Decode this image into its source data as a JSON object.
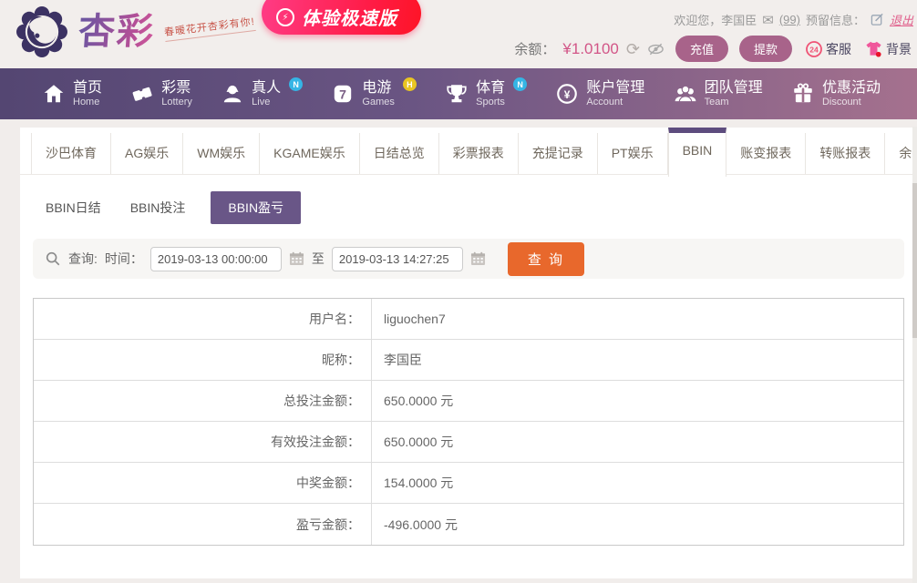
{
  "brand": {
    "name": "杏彩",
    "tagline": "春暖花开杏彩有你!",
    "speed_badge": "体验极速版"
  },
  "topbar": {
    "welcome": "欢迎您，李国臣",
    "mail_count": "(99)",
    "reserved_label": "预留信息：",
    "logout": "退出"
  },
  "balance": {
    "label": "余额：",
    "amount": "¥1.0100",
    "deposit": "充值",
    "withdraw": "提款",
    "service_badge": "24",
    "service": "客服",
    "background": "背景"
  },
  "icons": {
    "refresh": "⟳",
    "envelope": "✉",
    "lightning": "⚡"
  },
  "nav": {
    "items": [
      {
        "zh": "首页",
        "en": "Home",
        "badge": ""
      },
      {
        "zh": "彩票",
        "en": "Lottery",
        "badge": ""
      },
      {
        "zh": "真人",
        "en": "Live",
        "badge": "N"
      },
      {
        "zh": "电游",
        "en": "Games",
        "badge": "H",
        "icon_label": "7"
      },
      {
        "zh": "体育",
        "en": "Sports",
        "badge": "N"
      },
      {
        "zh": "账户管理",
        "en": "Account",
        "badge": "",
        "icon_label": "¥"
      },
      {
        "zh": "团队管理",
        "en": "Team",
        "badge": ""
      },
      {
        "zh": "优惠活动",
        "en": "Discount",
        "badge": ""
      }
    ]
  },
  "tabs": {
    "items": [
      "沙巴体育",
      "AG娱乐",
      "WM娱乐",
      "KGAME娱乐",
      "日结总览",
      "彩票报表",
      "充提记录",
      "PT娱乐",
      "BBIN",
      "账变报表",
      "转账报表",
      "余额查询"
    ],
    "active": "BBIN"
  },
  "subtabs": {
    "items": [
      "BBIN日结",
      "BBIN投注",
      "BBIN盈亏"
    ],
    "active": "BBIN盈亏"
  },
  "query": {
    "label": "查询:",
    "time_label": "时间：",
    "from": "2019-03-13 00:00:00",
    "between": "至",
    "to": "2019-03-13 14:27:25",
    "submit": "查 询"
  },
  "report": {
    "rows": [
      {
        "label": "用户名：",
        "value": "liguochen7"
      },
      {
        "label": "昵称：",
        "value": "李国臣"
      },
      {
        "label": "总投注金额：",
        "value": "650.0000 元"
      },
      {
        "label": "有效投注金额：",
        "value": "650.0000 元"
      },
      {
        "label": "中奖金额：",
        "value": "154.0000 元"
      },
      {
        "label": "盈亏金额：",
        "value": "-496.0000 元"
      }
    ]
  },
  "colors": {
    "accent_purple": "#5d4c7e",
    "subtab_purple": "#695687",
    "nav_gradient_start": "#544672",
    "nav_gradient_end": "#a5718e",
    "orange_button": "#e8682c",
    "badge_pink": "#ff1c47",
    "mauve_button": "#a8638a",
    "balance_amount_pink": "#d25587",
    "badge_blue": "#35b5e5",
    "badge_yellow": "#e9c522"
  }
}
